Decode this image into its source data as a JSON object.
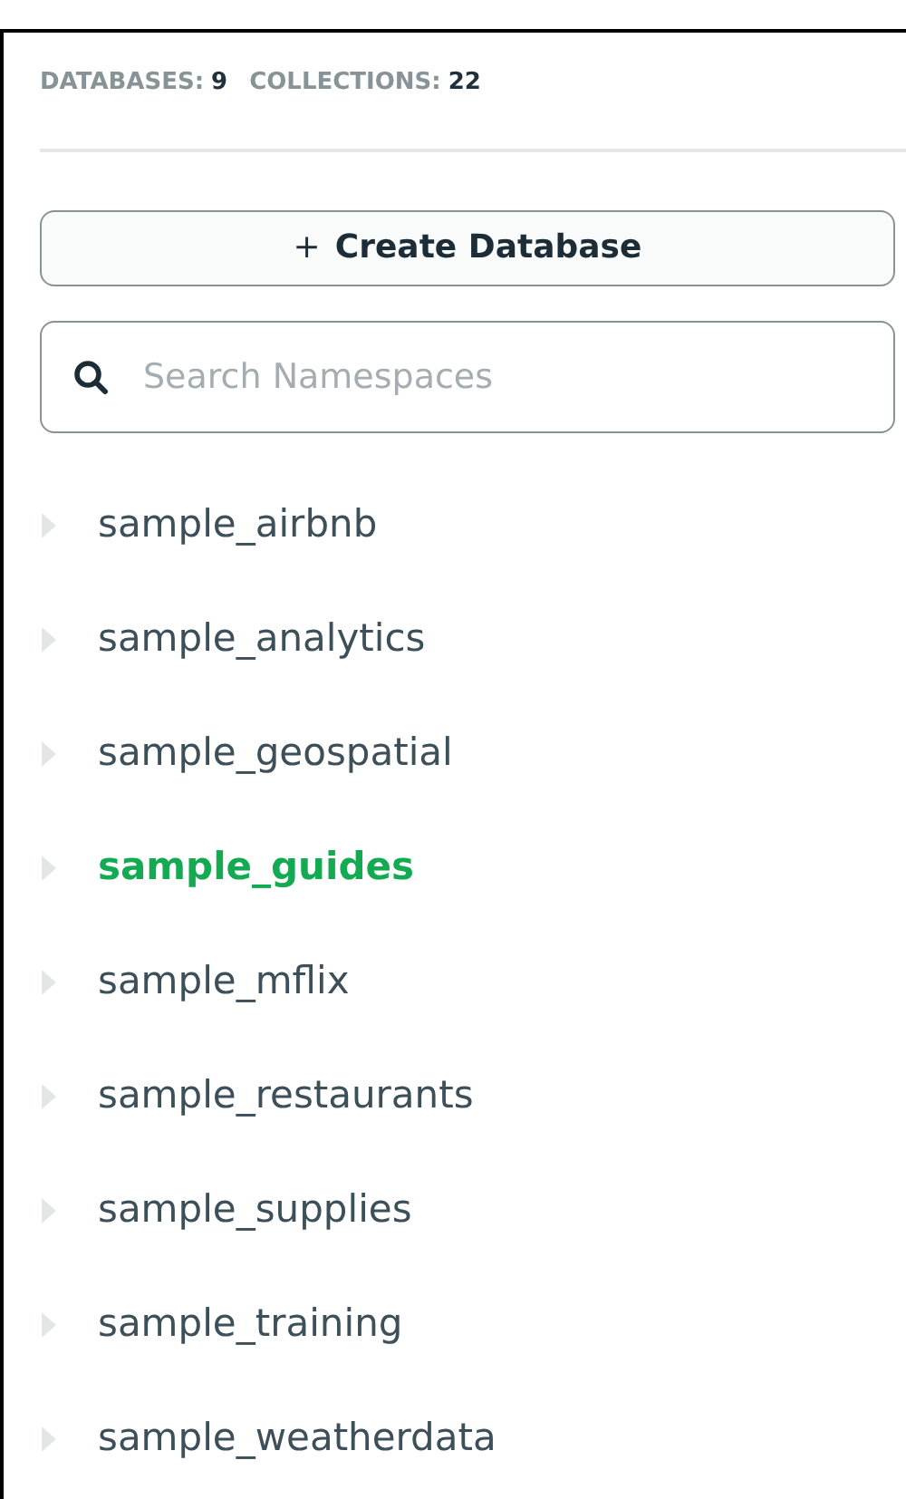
{
  "stats": [
    {
      "label": "DATABASES:",
      "value": "9"
    },
    {
      "label": "COLLECTIONS:",
      "value": "22"
    }
  ],
  "create_button": {
    "icon": "+",
    "label": "Create Database"
  },
  "search": {
    "placeholder": "Search Namespaces"
  },
  "databases": [
    {
      "name": "sample_airbnb",
      "selected": false
    },
    {
      "name": "sample_analytics",
      "selected": false
    },
    {
      "name": "sample_geospatial",
      "selected": false
    },
    {
      "name": "sample_guides",
      "selected": true
    },
    {
      "name": "sample_mflix",
      "selected": false
    },
    {
      "name": "sample_restaurants",
      "selected": false
    },
    {
      "name": "sample_supplies",
      "selected": false
    },
    {
      "name": "sample_training",
      "selected": false
    },
    {
      "name": "sample_weatherdata",
      "selected": false
    }
  ]
}
